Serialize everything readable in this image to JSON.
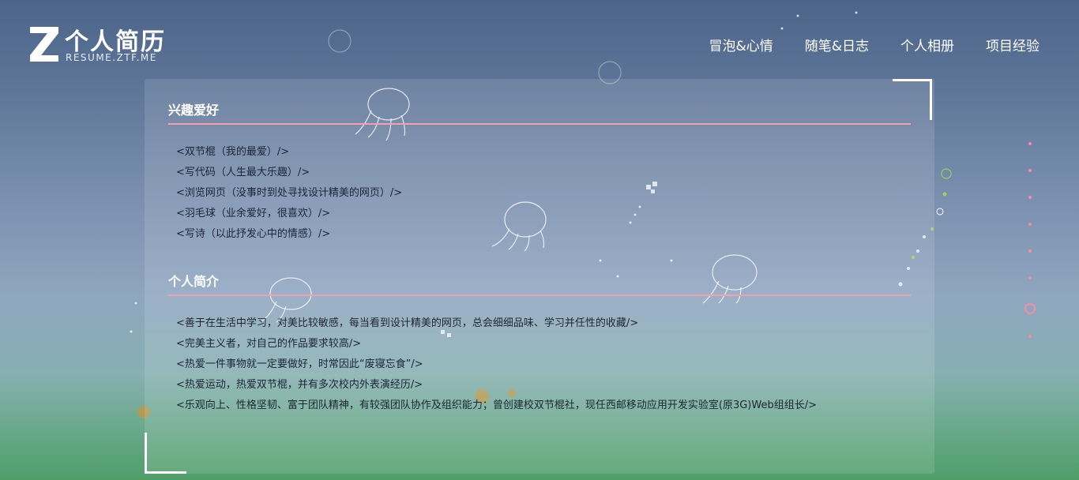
{
  "header": {
    "logo_title": "个人简历",
    "logo_subtitle": "RESUME.ZTF.ME",
    "logo_icon": "z-logo-icon",
    "nav": [
      {
        "label": "冒泡&心情"
      },
      {
        "label": "随笔&日志"
      },
      {
        "label": "个人相册"
      },
      {
        "label": "项目经验"
      }
    ]
  },
  "sections": [
    {
      "title": "兴趣爱好",
      "items": [
        "<双节棍（我的最爱）/>",
        "<写代码（人生最大乐趣）/>",
        "<浏览网页（没事时到处寻找设计精美的网页）/>",
        "<羽毛球（业余爱好，很喜欢）/>",
        "<写诗（以此抒发心中的情感）/>"
      ]
    },
    {
      "title": "个人简介",
      "items": [
        "<善于在生活中学习，对美比较敏感，每当看到设计精美的网页，总会细细品味、学习并任性的收藏/>",
        "<完美主义者，对自己的作品要求较高/>",
        "<热爱一件事物就一定要做好，时常因此“废寝忘食”/>",
        "<热爱运动，热爱双节棍，并有多次校内外表演经历/>",
        "<乐观向上、性格坚韧、富于团队精神，有较强团队协作及组织能力；曾创建校双节棍社，现任西邮移动应用开发实验室(原3G)Web组组长/>"
      ]
    }
  ],
  "pagination": {
    "count": 8,
    "active_index": 6
  },
  "colors": {
    "accent": "#f4a0b0",
    "dot": "#f48fa2",
    "text": "#1c2535",
    "heading": "#ffffff"
  }
}
